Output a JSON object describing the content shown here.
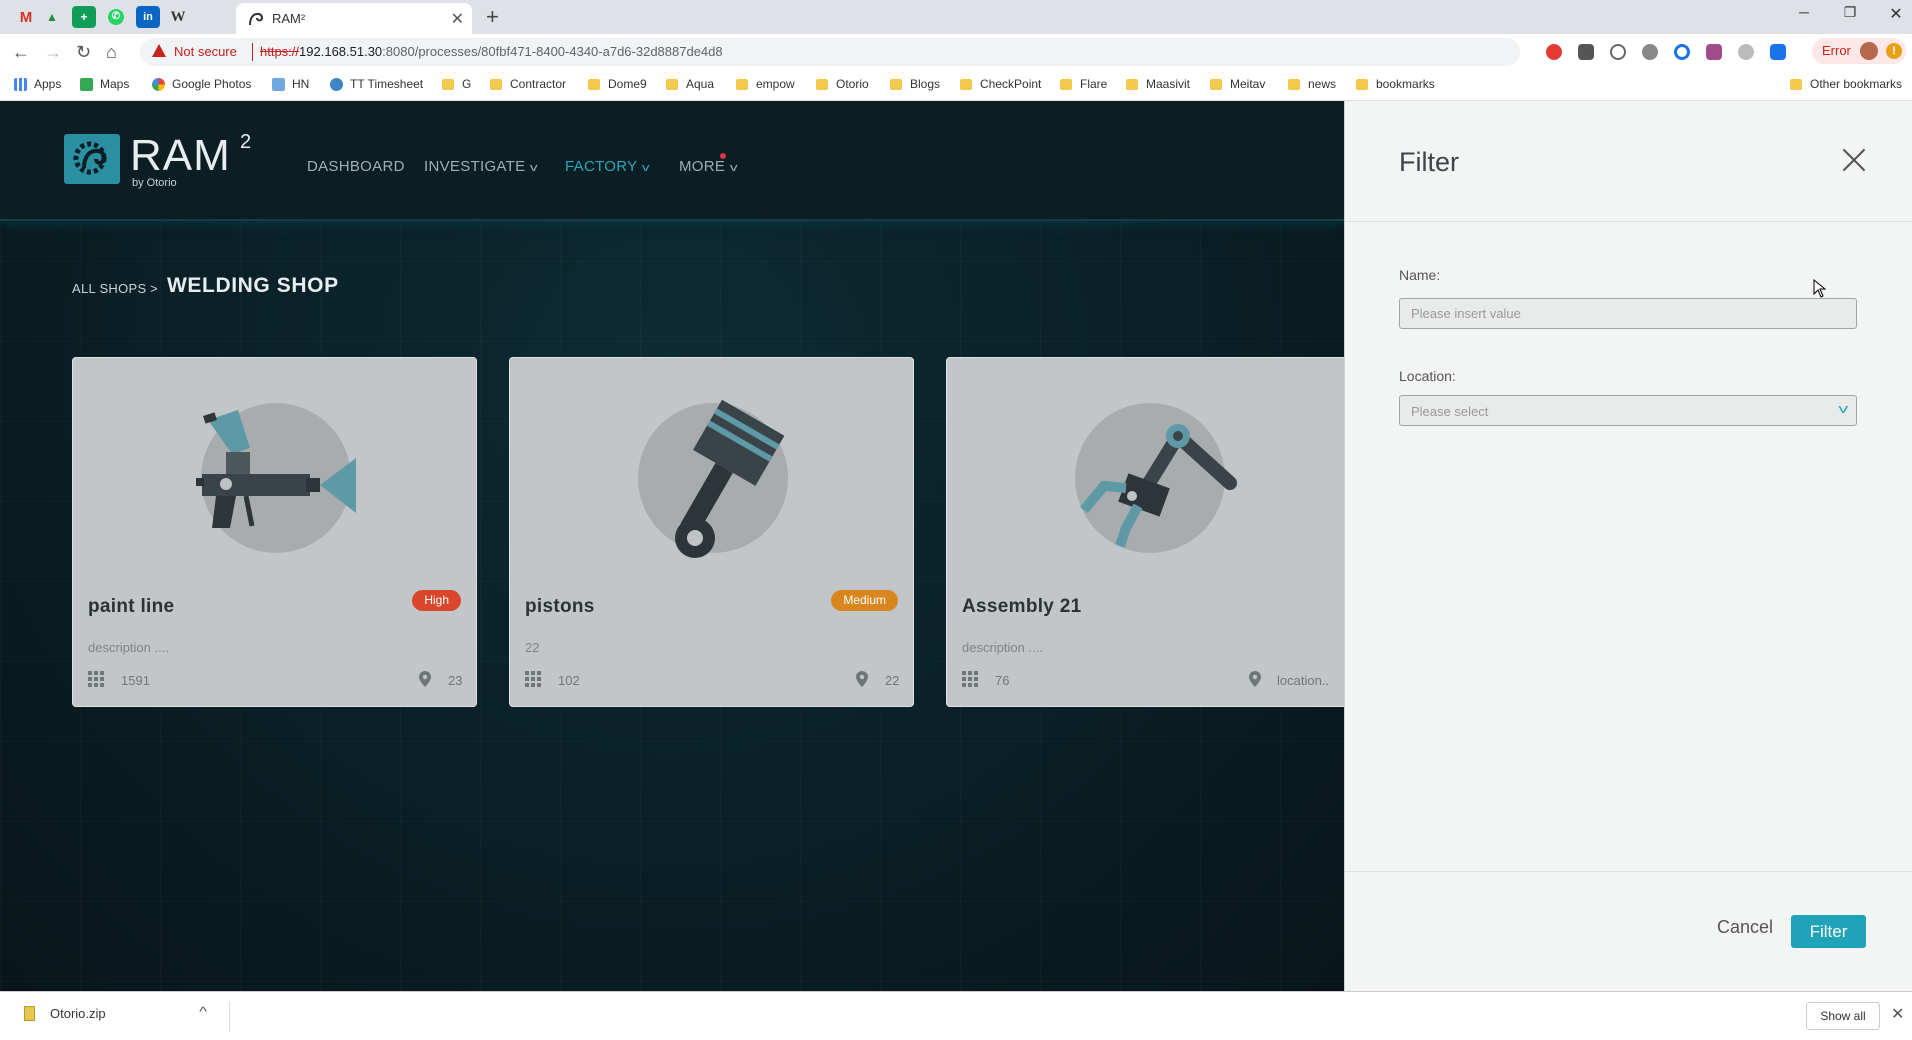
{
  "browser": {
    "tab_title": "RAM²",
    "url": {
      "protocol": "https://",
      "host": "192.168.51.30",
      "rest": ":8080/processes/80fbf471-8400-4340-a7d6-32d8887de4d8"
    },
    "security_label": "Not secure",
    "error_label": "Error",
    "error_badge": "!",
    "new_tab": "+",
    "close_tab": "✕",
    "bookmarks": [
      "Apps",
      "Maps",
      "Google Photos",
      "HN",
      "TT Timesheet",
      "G",
      "Contractor",
      "Dome9",
      "Aqua",
      "empow",
      "Otorio",
      "Blogs",
      "CheckPoint",
      "Flare",
      "Maasivit",
      "Meitav",
      "news",
      "bookmarks"
    ],
    "other_bookmarks": "Other bookmarks",
    "pinned_tabs": [
      {
        "icon": "gmail-icon",
        "glyph": "M",
        "color": "#d93025"
      },
      {
        "icon": "drive-icon",
        "glyph": "▲",
        "color": "#1e8e3e"
      },
      {
        "icon": "sheets-icon",
        "glyph": "+",
        "color": "#0f9d58"
      },
      {
        "icon": "whatsapp-icon",
        "glyph": "✆",
        "color": "#25d366"
      },
      {
        "icon": "linkedin-icon",
        "glyph": "in",
        "color": "#0a66c2"
      },
      {
        "icon": "wikipedia-icon",
        "glyph": "W",
        "color": "#333333"
      }
    ]
  },
  "app": {
    "logo": {
      "name": "RAM",
      "sup": "2",
      "by": "by Otorio"
    },
    "nav": [
      {
        "label": "DASHBOARD",
        "has_menu": false,
        "active": false
      },
      {
        "label": "INVESTIGATE",
        "has_menu": true,
        "active": false
      },
      {
        "label": "FACTORY",
        "has_menu": true,
        "active": true
      },
      {
        "label": "MORE",
        "has_menu": true,
        "active": false
      }
    ],
    "breadcrumb": {
      "all": "ALL SHOPS",
      "separator": ">",
      "current": "WELDING SHOP"
    },
    "cards": [
      {
        "name": "paint line",
        "badge": "High",
        "badge_color": "#d9462b",
        "description": "description ....",
        "count": "1591",
        "location": "23",
        "icon": "spray-gun-icon"
      },
      {
        "name": "pistons",
        "badge": "Medium",
        "badge_color": "#d9861e",
        "description": "22",
        "count": "102",
        "location": "22",
        "icon": "piston-icon"
      },
      {
        "name": "Assembly 21",
        "badge": "",
        "badge_color": "",
        "description": "description ....",
        "count": "76",
        "location": "location..",
        "icon": "robot-arm-icon"
      }
    ]
  },
  "filter": {
    "title": "Filter",
    "name_label": "Name:",
    "name_placeholder": "Please insert value",
    "name_value": "",
    "location_label": "Location:",
    "location_placeholder": "Please select",
    "cancel": "Cancel",
    "submit": "Filter"
  },
  "downloads": {
    "file": "Otorio.zip",
    "show_all": "Show all"
  },
  "colors": {
    "accent": "#1fa3b8",
    "app_bg": "#0a1f26",
    "card_bg": "#c3c6c8",
    "high": "#d9462b",
    "medium": "#d9861e"
  }
}
